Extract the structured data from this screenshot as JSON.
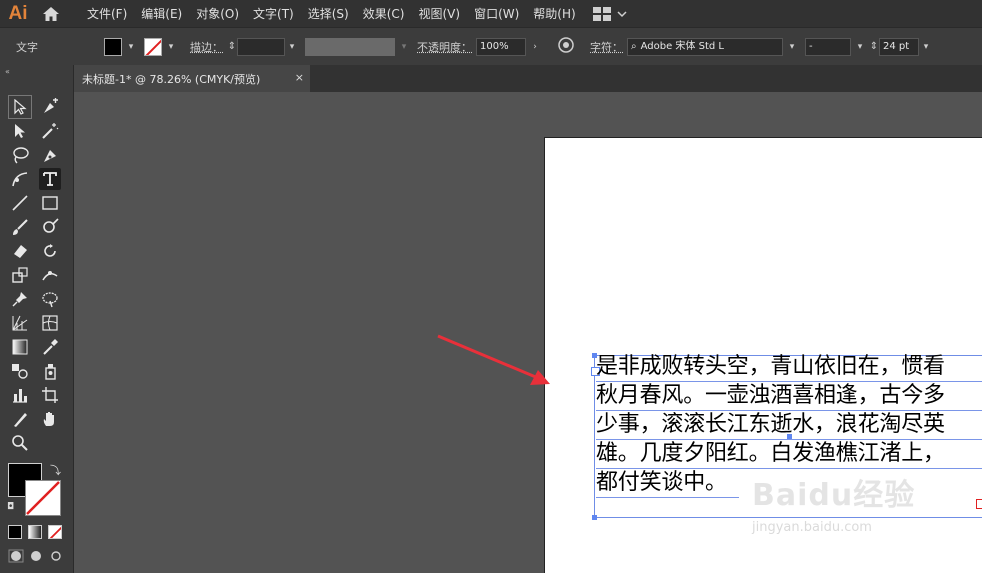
{
  "app": {
    "logo": "Ai"
  },
  "menu": [
    "文件(F)",
    "编辑(E)",
    "对象(O)",
    "文字(T)",
    "选择(S)",
    "效果(C)",
    "视图(V)",
    "窗口(W)",
    "帮助(H)"
  ],
  "control_bar": {
    "context_label": "文字",
    "stroke_label": "描边：",
    "opacity_label": "不透明度：",
    "opacity_value": "100%",
    "char_label": "字符：",
    "font_name": "Adobe 宋体 Std L",
    "font_style": "-",
    "font_size": "24 pt"
  },
  "tab": {
    "title": "未标题-1* @ 78.26% (CMYK/预览)",
    "close": "×"
  },
  "document": {
    "lines": [
      "是非成败转头空，青山依旧在，惯看",
      "秋月春风。一壶浊酒喜相逢，古今多",
      "少事，滚滚长江东逝水，浪花淘尽英",
      "雄。几度夕阳红。白发渔樵江渚上，",
      "都付笑谈中。"
    ]
  },
  "watermark": {
    "brand": "Baidu经验",
    "url": "jingyan.baidu.com"
  },
  "colors": {
    "accent_logo": "#e3843a",
    "selection": "#5f86f0",
    "arrow": "#e8303a"
  }
}
